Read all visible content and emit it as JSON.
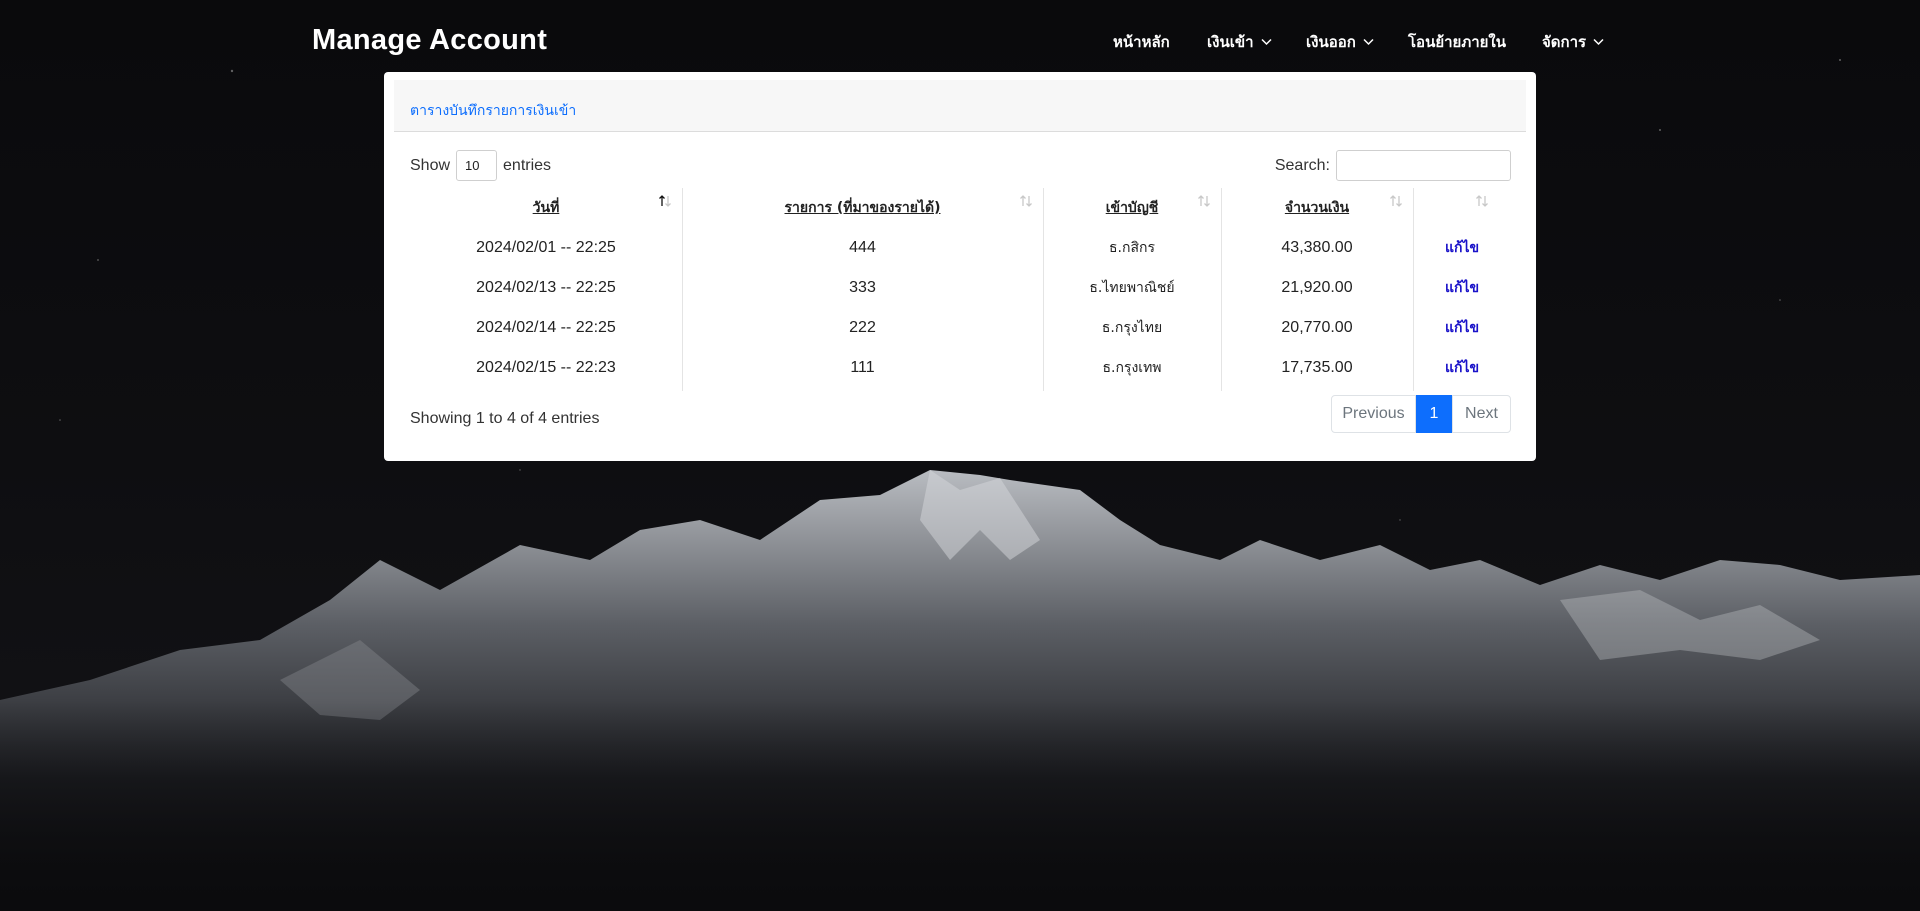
{
  "brand": "Manage Account",
  "nav": [
    {
      "label": "หน้าหลัก",
      "dropdown": false
    },
    {
      "label": "เงินเข้า",
      "dropdown": true
    },
    {
      "label": "เงินออก",
      "dropdown": true
    },
    {
      "label": "โอนย้ายภายใน",
      "dropdown": false
    },
    {
      "label": "จัดการ",
      "dropdown": true
    }
  ],
  "card": {
    "title": "ตารางบันทึกรายการเงินเข้า",
    "show_label": "Show",
    "entries_value": "10",
    "entries_label": "entries",
    "search_label": "Search:",
    "search_value": ""
  },
  "table": {
    "headers": [
      "วันที่",
      "รายการ (ที่มาของรายได้)",
      "เข้าบัญชี",
      "จำนวนเงิน",
      ""
    ],
    "rows": [
      {
        "date": "2024/02/01 -- 22:25",
        "item": "444",
        "account": "ธ.กสิกร",
        "amount": "43,380.00",
        "action": "แก้ไข"
      },
      {
        "date": "2024/02/13 -- 22:25",
        "item": "333",
        "account": "ธ.ไทยพาณิชย์",
        "amount": "21,920.00",
        "action": "แก้ไข"
      },
      {
        "date": "2024/02/14 -- 22:25",
        "item": "222",
        "account": "ธ.กรุงไทย",
        "amount": "20,770.00",
        "action": "แก้ไข"
      },
      {
        "date": "2024/02/15 -- 22:23",
        "item": "111",
        "account": "ธ.กรุงเทพ",
        "amount": "17,735.00",
        "action": "แก้ไข"
      }
    ]
  },
  "footer": {
    "info": "Showing 1 to 4 of 4 entries",
    "prev": "Previous",
    "current_page": "1",
    "next": "Next"
  },
  "colors": {
    "accent": "#0d6efd",
    "edit_link": "#1a12c9",
    "page_bg": "#050506"
  }
}
